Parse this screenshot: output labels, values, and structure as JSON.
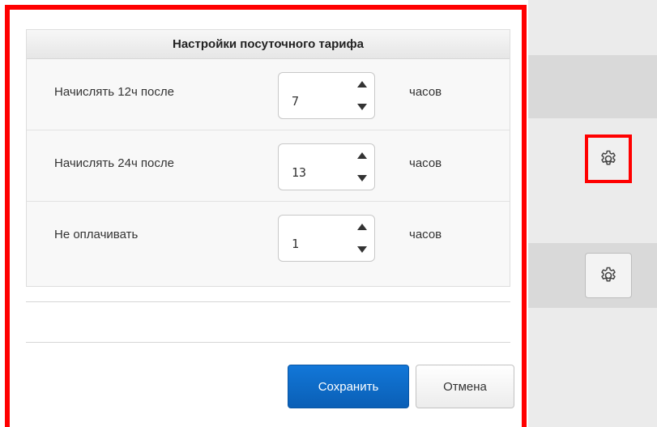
{
  "dialog": {
    "title": "Настройки посуточного тарифа",
    "rows": [
      {
        "label": "Начислять 12ч после",
        "value": "7",
        "unit": "часов"
      },
      {
        "label": "Начислять 24ч после",
        "value": "13",
        "unit": "часов"
      },
      {
        "label": "Не оплачивать",
        "value": "1",
        "unit": "часов"
      }
    ],
    "save_label": "Сохранить",
    "cancel_label": "Отмена"
  },
  "background": {
    "gear_buttons": [
      {
        "icon": "gear-icon",
        "highlighted": true
      },
      {
        "icon": "gear-icon",
        "highlighted": false
      }
    ]
  },
  "colors": {
    "highlight": "#ff0000",
    "primary": "#0a66c2"
  }
}
